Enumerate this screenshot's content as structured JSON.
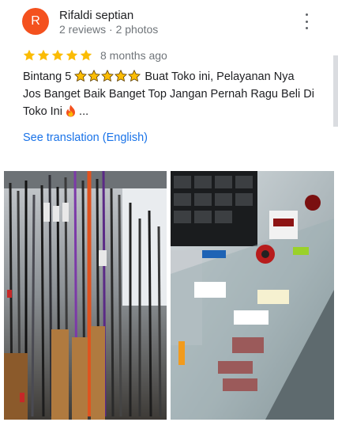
{
  "reviewer": {
    "initial": "R",
    "name": "Rifaldi septian",
    "meta": "2 reviews · 2 photos",
    "avatar_color": "#f4511e"
  },
  "review": {
    "stars": 5,
    "time": "8 months ago",
    "text_prefix": "Bintang 5",
    "inline_stars": 5,
    "text_body": "Buat Toko ini, Pelayanan Nya Jos Banget Baik Banget Top Jangan Pernah Ragu Beli Di Toko Ini",
    "text_suffix": "...",
    "see_translation": "See translation (English)"
  },
  "photos": [
    {
      "icon": "fishing-rods-photo"
    },
    {
      "icon": "fishing-reels-display-case-photo"
    }
  ],
  "colors": {
    "star": "#fbbc04",
    "link": "#1a73e8",
    "muted": "#70757a"
  }
}
